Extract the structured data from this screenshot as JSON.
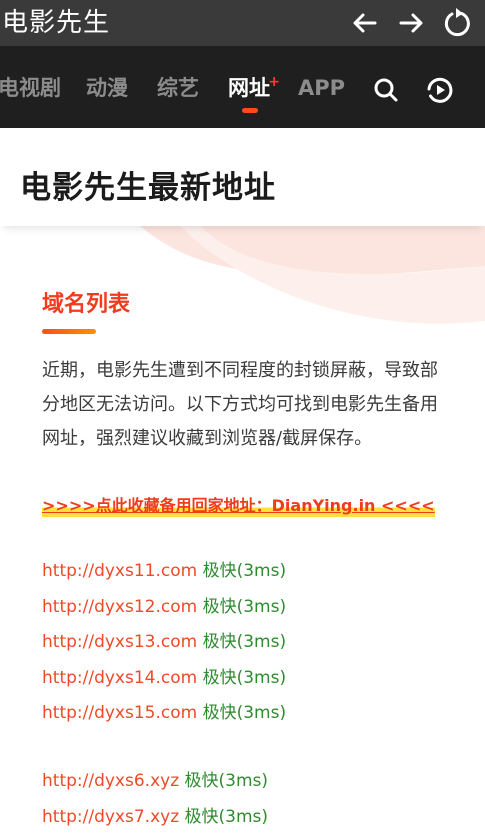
{
  "titlebar": {
    "title": "电影先生"
  },
  "nav": {
    "items": [
      {
        "label": "电视剧"
      },
      {
        "label": "动漫"
      },
      {
        "label": "综艺"
      },
      {
        "label": "网址",
        "badge": "+"
      },
      {
        "label": "APP"
      }
    ],
    "active_index": 3
  },
  "page": {
    "title": "电影先生最新地址"
  },
  "section": {
    "title": "域名列表",
    "intro": "近期，电影先生遭到不同程度的封锁屏蔽，导致部分地区无法访问。以下方式均可找到电影先生备用网址，强烈建议收藏到浏览器/截屏保存。",
    "promo": ">>>>点此收藏备用回家地址：DianYing.in <<<<"
  },
  "links_group1": [
    {
      "url": "http://dyxs11.com",
      "speed": "极快(3ms)"
    },
    {
      "url": "http://dyxs12.com",
      "speed": "极快(3ms)"
    },
    {
      "url": "http://dyxs13.com",
      "speed": "极快(3ms)"
    },
    {
      "url": "http://dyxs14.com",
      "speed": "极快(3ms)"
    },
    {
      "url": "http://dyxs15.com",
      "speed": "极快(3ms)"
    }
  ],
  "links_group2": [
    {
      "url": "http://dyxs6.xyz",
      "speed": "极快(3ms)"
    },
    {
      "url": "http://dyxs7.xyz",
      "speed": "极快(3ms)"
    }
  ],
  "colors": {
    "accent": "#f23a1d",
    "url": "#ee4a28",
    "speed": "#2e8b2e",
    "highlight": "#ffe03b",
    "titlebar_bg": "#3a3a3a",
    "navbar_bg": "#1f1f1f"
  },
  "icons": [
    "back-arrow-icon",
    "forward-arrow-icon",
    "refresh-icon",
    "search-icon",
    "play-history-icon"
  ]
}
